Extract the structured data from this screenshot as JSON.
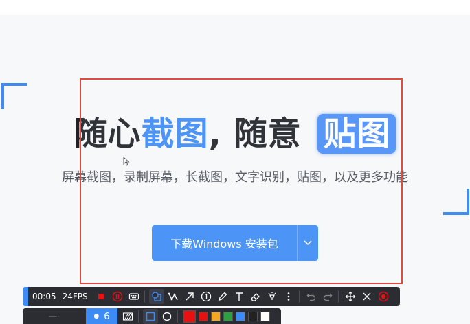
{
  "hero": {
    "title_part1": "随心",
    "title_part2": "截图",
    "title_part3": ", 随意 ",
    "title_part4": "贴图",
    "subtitle": "屏幕截图，录制屏幕，长截图，文字识别，贴图，以及更多功能"
  },
  "cta": {
    "label": "下载Windows 安装包",
    "dropdown_icon": "chevron-down-icon"
  },
  "recorder": {
    "elapsed": "00:05",
    "fps": "24FPS",
    "stroke_size": "6",
    "tools": [
      "shape-icon",
      "polyline-icon",
      "arrow-icon",
      "number-icon",
      "pencil-icon",
      "text-icon",
      "eraser-icon",
      "spotlight-icon",
      "more-icon",
      "undo-icon",
      "redo-icon",
      "move-icon",
      "close-icon",
      "record-icon"
    ],
    "palette": [
      "#e81010",
      "#e81010",
      "#f5a623",
      "#2ea043",
      "#3d8bf5",
      "#222222",
      "#ffffff"
    ]
  },
  "colors": {
    "accent": "#3d8bf5",
    "capture_border": "#e04a3f",
    "toolbar_bg": "#2b2d33"
  }
}
